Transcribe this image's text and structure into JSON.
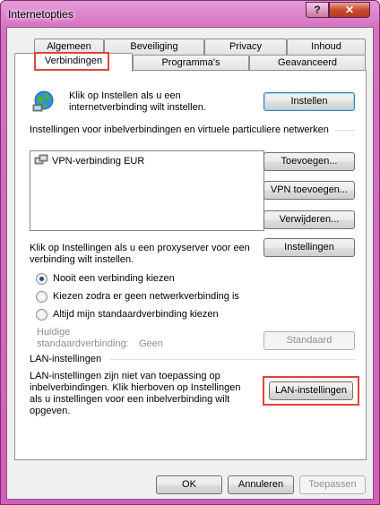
{
  "window": {
    "title": "Internetopties",
    "help_label": "?",
    "close_label": "✕"
  },
  "tabs_row1": [
    {
      "label": "Algemeen"
    },
    {
      "label": "Beveiliging"
    },
    {
      "label": "Privacy"
    },
    {
      "label": "Inhoud"
    }
  ],
  "tabs_row2": [
    {
      "label": "Verbindingen",
      "active": true
    },
    {
      "label": "Programma's"
    },
    {
      "label": "Geavanceerd"
    }
  ],
  "setup": {
    "icon": "globe-network-icon",
    "text": "Klik op Instellen als u een internetverbinding wilt instellen.",
    "button": "Instellen"
  },
  "dialup": {
    "heading": "Instellingen voor inbelverbindingen en virtuele particuliere netwerken",
    "list_items": [
      {
        "icon": "vpn-connection-icon",
        "label": "VPN-verbinding EUR"
      }
    ],
    "add_button": "Toevoegen...",
    "add_vpn_button": "VPN toevoegen...",
    "remove_button": "Verwijderen...",
    "proxy_text": "Klik op Instellingen als u een proxyserver voor een verbinding wilt instellen.",
    "settings_button": "Instellingen",
    "radios": [
      {
        "label": "Nooit een verbinding kiezen",
        "checked": true
      },
      {
        "label": "Kiezen zodra er geen netwerkverbinding is",
        "checked": false
      },
      {
        "label": "Altijd mijn standaardverbinding kiezen",
        "checked": false
      }
    ],
    "current_label": "Huidige standaardverbinding:",
    "current_value": "Geen",
    "default_button": "Standaard"
  },
  "lan": {
    "heading": "LAN-instellingen",
    "text": "LAN-instellingen zijn niet van toepassing op inbelverbindingen. Klik hierboven op Instellingen als u instellingen voor een inbelverbinding wilt opgeven.",
    "button": "LAN-instellingen"
  },
  "footer": {
    "ok": "OK",
    "cancel": "Annuleren",
    "apply": "Toepassen"
  },
  "colors": {
    "highlight": "#e0443a",
    "title_bar": "#d671c3"
  }
}
